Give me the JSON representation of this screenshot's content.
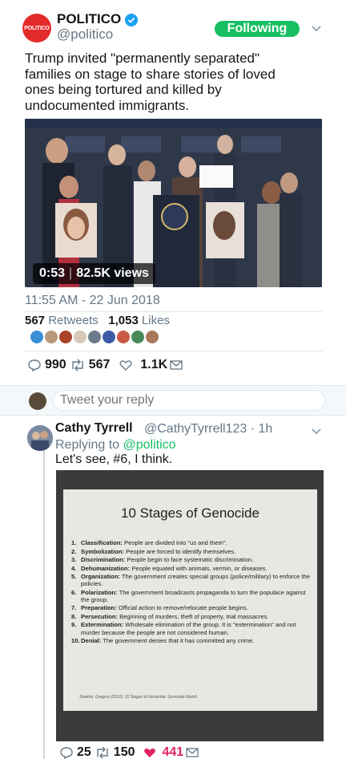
{
  "main_tweet": {
    "avatar_label": "POLITICO",
    "display_name": "POLITICO",
    "handle": "@politico",
    "follow_label": "Following",
    "text": "Trump invited \"permanently separated\" families on stage to share stories of loved ones being tortured and killed by undocumented immigrants.",
    "video": {
      "duration": "0:53",
      "views": "82.5K views"
    },
    "timestamp": "11:55 AM - 22 Jun 2018",
    "retweets_count": "567",
    "retweets_label": "Retweets",
    "likes_count": "1,053",
    "likes_label": "Likes",
    "actions": {
      "replies": "990",
      "retweets": "567",
      "likes": "1.1K"
    }
  },
  "reply_box": {
    "placeholder": "Tweet your reply"
  },
  "reply_tweet": {
    "display_name": "Cathy Tyrrell",
    "handle_time": "@CathyTyrrell123 · 1h",
    "replying_to_label": "Replying to",
    "replying_to_handle": "@politico",
    "text": "Let's see, #6, I think.",
    "image": {
      "title": "10 Stages of Genocide",
      "stages": [
        {
          "num": "1.",
          "term": "Classification:",
          "desc": "People are divided into \"us and them\"."
        },
        {
          "num": "2.",
          "term": "Symbolization:",
          "desc": "People are forced to identify themselves."
        },
        {
          "num": "3.",
          "term": "Discrimination:",
          "desc": "People begin to face systematic discrimination."
        },
        {
          "num": "4.",
          "term": "Dehumanization:",
          "desc": "People equated with animals, vermin, or diseases."
        },
        {
          "num": "5.",
          "term": "Organization:",
          "desc": "The government creates special groups (police/military) to enforce the policies."
        },
        {
          "num": "6.",
          "term": "Polarization:",
          "desc": "The government broadcasts propaganda to turn the populace against the group."
        },
        {
          "num": "7.",
          "term": "Preparation:",
          "desc": "Official action to remove/relocate people begins."
        },
        {
          "num": "8.",
          "term": "Persecution:",
          "desc": "Beginning of murders, theft of property, trial massacres."
        },
        {
          "num": "9.",
          "term": "Extermination:",
          "desc": "Wholesale elimination of the group. It is \"extermination\" and not murder because the people are not considered human."
        },
        {
          "num": "10.",
          "term": "Denial:",
          "desc": "The government denies that it has committed any crime."
        }
      ],
      "source": "Stanton, Gregory (2012). 10 Stages of Genocide. Genocide Watch"
    },
    "actions": {
      "replies": "25",
      "retweets": "150",
      "likes": "441"
    }
  },
  "colors": {
    "brand_red": "#e32b2b",
    "following_green": "#17bf63",
    "verified_blue": "#1da1f2",
    "like_pink": "#e0245e",
    "muted_text": "#657786"
  }
}
